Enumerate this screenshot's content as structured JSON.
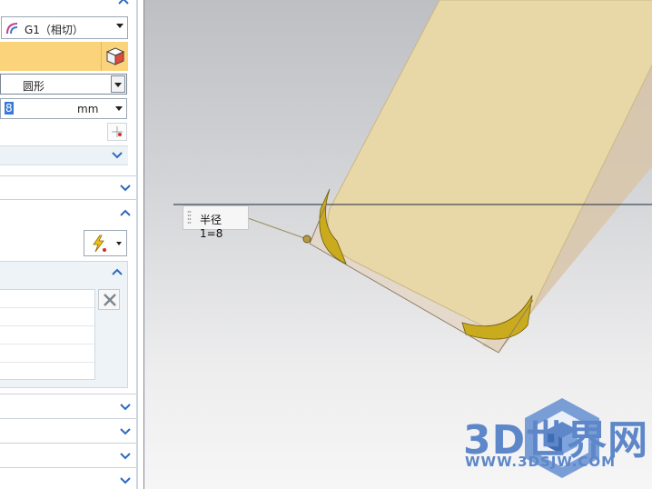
{
  "dialog": {
    "continuity": {
      "selected": "G1（相切）",
      "icon": "continuity-curve-icon"
    },
    "cross_section": {
      "shape_selected": "圆形"
    },
    "radius": {
      "value": "8",
      "unit": "mm"
    }
  },
  "viewport": {
    "dimension_label": "半径 1=8",
    "watermark": {
      "brand": "3D世界网",
      "url": "WWW.3DSJW.COM",
      "color": "#5d87c9"
    },
    "body_color": "#e8d7a7",
    "blend_color": "#c9ab1d"
  }
}
